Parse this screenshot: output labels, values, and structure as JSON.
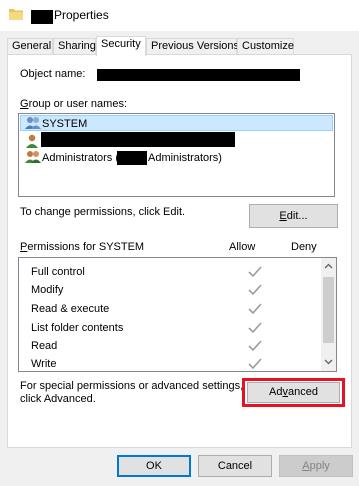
{
  "window": {
    "title": "Properties",
    "icon": "folder-icon"
  },
  "tabs": [
    {
      "label": "General"
    },
    {
      "label": "Sharing"
    },
    {
      "label": "Security",
      "active": true
    },
    {
      "label": "Previous Versions"
    },
    {
      "label": "Customize"
    }
  ],
  "security": {
    "object_name_label": "Object name:",
    "group_label_prefix": "G",
    "group_label_rest": "roup or user names:",
    "principals": [
      {
        "name": "SYSTEM",
        "icon": "user-group-icon",
        "selected": true
      },
      {
        "name": ")",
        "icon": "user-icon",
        "redacted": true
      },
      {
        "name": "Administrators (",
        "suffix": "Administrators)",
        "icon": "user-group-icon",
        "redacted": true
      }
    ],
    "change_text": "To change permissions, click Edit.",
    "edit_button": {
      "prefix": "E",
      "rest": "dit..."
    },
    "permissions_for_prefix": "P",
    "permissions_for_rest": "ermissions for SYSTEM",
    "allow_header": "Allow",
    "deny_header": "Deny",
    "permissions": [
      {
        "name": "Full control",
        "allow": true
      },
      {
        "name": "Modify",
        "allow": true
      },
      {
        "name": "Read & execute",
        "allow": true
      },
      {
        "name": "List folder contents",
        "allow": true
      },
      {
        "name": "Read",
        "allow": true
      },
      {
        "name": "Write",
        "allow": true
      }
    ],
    "advanced_text_line1": "For special permissions or advanced settings,",
    "advanced_text_line2": "click Advanced.",
    "advanced_button": {
      "prefix": "Ad",
      "underlined": "v",
      "rest": "anced"
    }
  },
  "footer": {
    "ok": "OK",
    "cancel": "Cancel",
    "apply_prefix": "",
    "apply_underlined": "A",
    "apply_rest": "pply"
  },
  "colors": {
    "selection": "#cce8ff",
    "highlight_box": "#e81123",
    "checkmark": "#9e9e9e",
    "ok_border": "#0078d7"
  }
}
